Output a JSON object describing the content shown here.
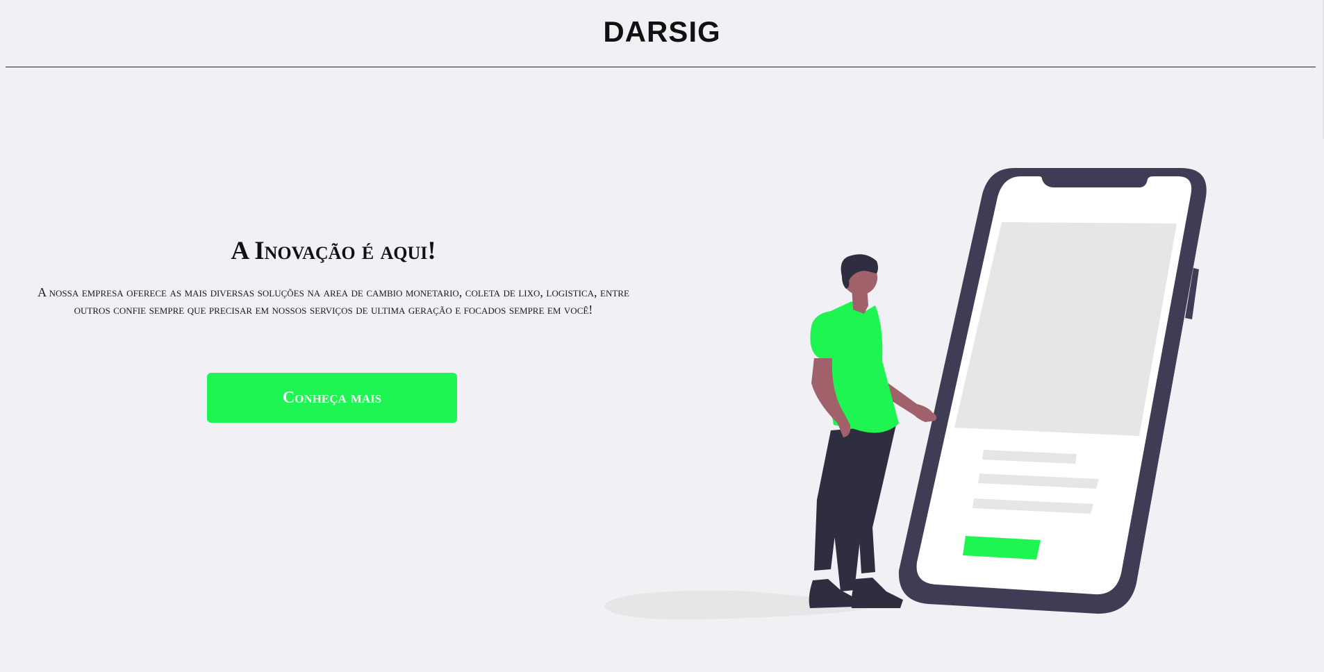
{
  "header": {
    "brand": "DARSIG"
  },
  "hero": {
    "title": "A Inovação é aqui!",
    "description": "A nossa empresa oferece as mais diversas soluções na area de cambio monetario, coleta de lixo, logistica, entre outros confie sempre que precisar em nossos serviços de ultima geração e focados sempre em você!",
    "cta_label": "Conheça mais"
  },
  "colors": {
    "background": "#f0f0f5",
    "accent": "#1ef553",
    "phone_frame": "#3f3d56",
    "skin": "#a0616a",
    "pants": "#2f2e41"
  },
  "illustration": {
    "icon": "person-with-smartphone-illustration"
  }
}
